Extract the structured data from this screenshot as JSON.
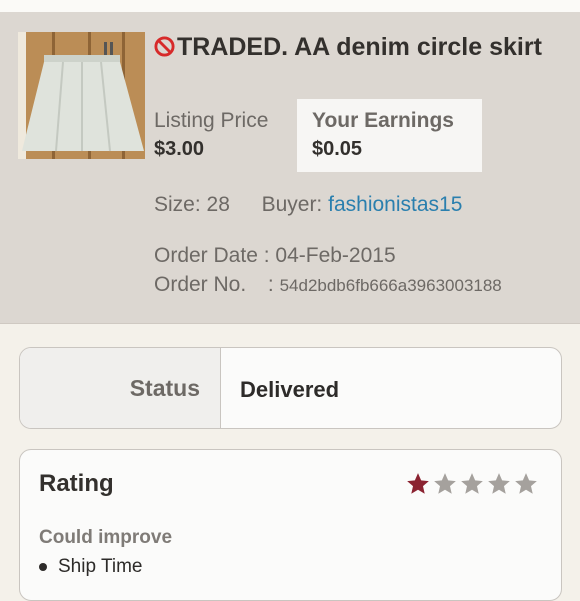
{
  "listing": {
    "title": "TRADED. AA denim circle skirt",
    "title_prefix_icon": "no-entry-icon",
    "image_alt": "white denim circle skirt photo",
    "listing_price_label": "Listing Price",
    "listing_price": "$3.00",
    "earnings_label": "Your Earnings",
    "earnings": "$0.05",
    "size_label": "Size:",
    "size": "28",
    "buyer_label": "Buyer:",
    "buyer": "fashionistas15",
    "order_date_label": "Order Date :",
    "order_date": "04-Feb-2015",
    "order_no_label": "Order No.",
    "order_no_sep": ":",
    "order_no": "54d2bdb6fb666a3963003188"
  },
  "status": {
    "label": "Status",
    "value": "Delivered"
  },
  "rating": {
    "label": "Rating",
    "stars_filled": 1,
    "stars_total": 5,
    "star_filled_color": "#8b2331",
    "star_empty_color": "#a5a19d",
    "improve_label": "Could improve",
    "improve_items": [
      "Ship Time"
    ]
  }
}
